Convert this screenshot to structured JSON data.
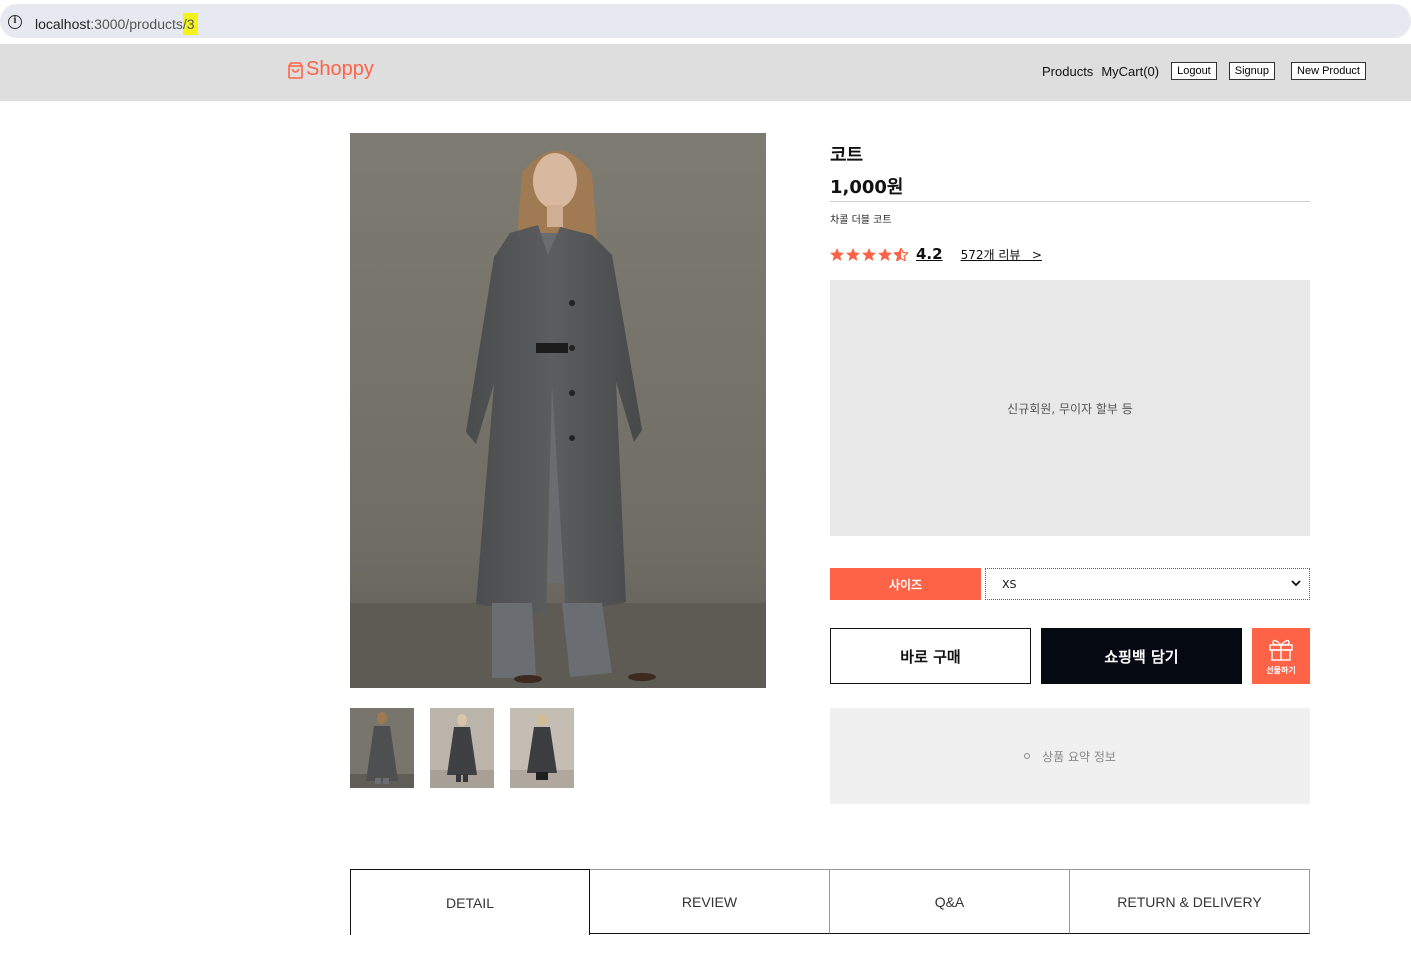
{
  "browser": {
    "url_host": "localhost",
    "url_rest": ":3000/products",
    "url_highlight": "/3"
  },
  "header": {
    "logo": "Shoppy",
    "brand_color": "#ff6347",
    "nav": {
      "products": "Products",
      "mycart": "MyCart(0)",
      "logout": "Logout",
      "signup": "Signup",
      "new_product": "New Product"
    }
  },
  "product": {
    "name": "코트",
    "price": "1,000원",
    "description": "차콜 더블 코트",
    "rating": "4.2",
    "rating_stars": 4.5,
    "reviews": "572개 리뷰   >",
    "promo": "신규회원, 무이자 할부 등",
    "size_label": "사이즈",
    "size_selected": "XS",
    "buy_now": "바로 구매",
    "add_to_bag": "쇼핑백 담기",
    "gift": "선물하기",
    "summary": "상품 요약 정보",
    "thumbnail_count": 3
  },
  "tabs": [
    "DETAIL",
    "REVIEW",
    "Q&A",
    "RETURN & DELIVERY"
  ]
}
